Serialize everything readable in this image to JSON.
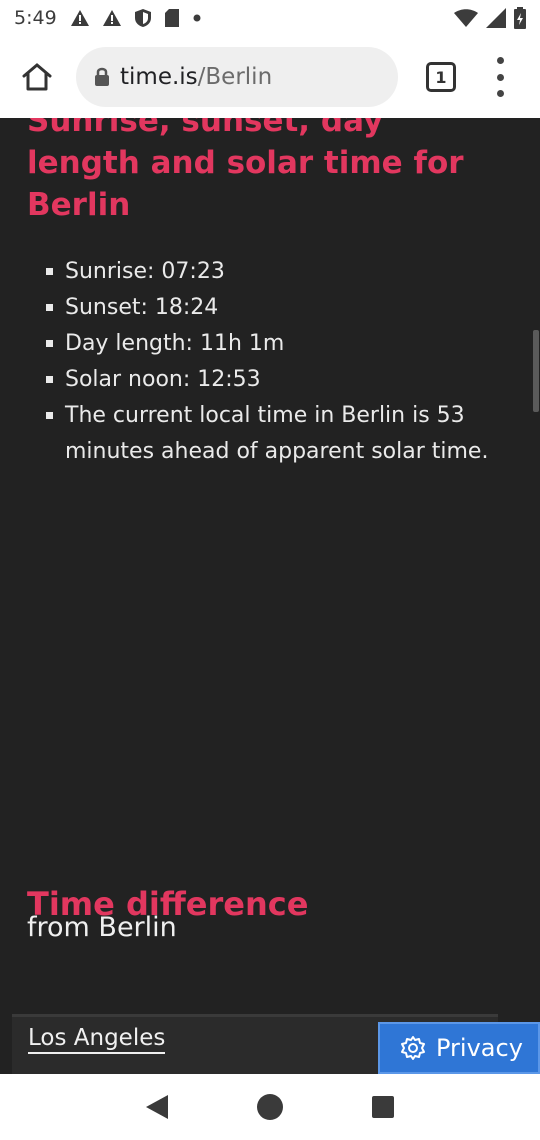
{
  "status_bar": {
    "time": "5:49",
    "icons_left": [
      "warning-icon",
      "warning-icon",
      "shield-icon",
      "sd-card-icon",
      "dot-icon"
    ],
    "icons_right": [
      "wifi-icon",
      "signal-icon",
      "battery-icon"
    ]
  },
  "browser": {
    "url_host": "time.is",
    "url_path": "/Berlin",
    "tab_count": "1"
  },
  "sun_section": {
    "heading": "Sunrise, sunset, day length and solar time for Berlin",
    "items": [
      "Sunrise: 07:23",
      "Sunset: 18:24",
      "Day length: 11h 1m",
      "Solar noon: 12:53",
      "The current local time in Berlin is 53 minutes ahead of apparent solar time."
    ]
  },
  "time_difference": {
    "heading": "Time difference",
    "subheading": "from Berlin",
    "city": "Los Angeles"
  },
  "privacy_button": {
    "label": "Privacy"
  },
  "colors": {
    "accent": "#e2375f",
    "page_bg": "#222222",
    "privacy_bg": "#2f76d6"
  }
}
